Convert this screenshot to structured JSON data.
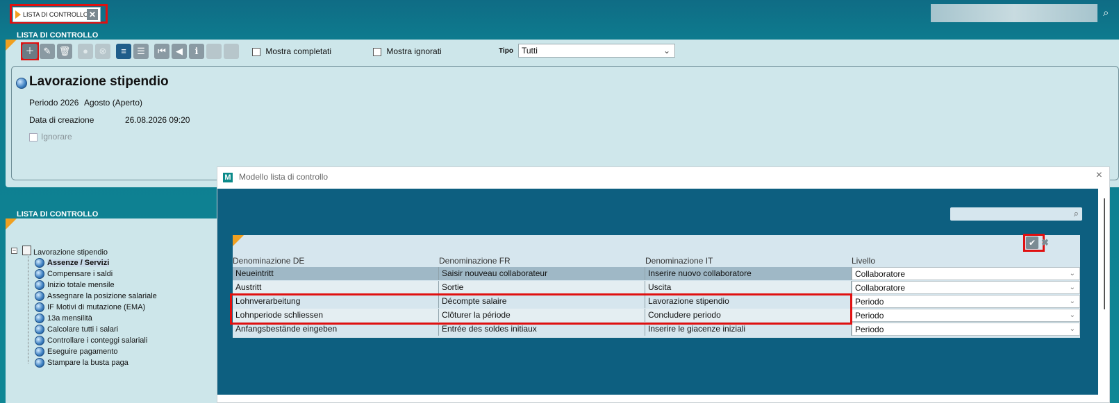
{
  "tab": {
    "label": "LISTA DI CONTROLLO",
    "close": "✕"
  },
  "checklist_section": {
    "title": "LISTA DI CONTROLLO"
  },
  "toolbar": {
    "show_completed": "Mostra completati",
    "show_ignored": "Mostra ignorati",
    "type_label": "Tipo",
    "type_value": "Tutti"
  },
  "detail": {
    "title": "Lavorazione stipendio",
    "period_label": "Periodo 2026",
    "period_value": "Agosto (Aperto)",
    "created_label": "Data di creazione",
    "created_value": "26.08.2026 09:20",
    "ignore_label": "Ignorare"
  },
  "tree_section": {
    "title": "LISTA DI CONTROLLO"
  },
  "tree": {
    "root": "Lavorazione stipendio",
    "items": [
      "Assenze / Servizi",
      "Compensare i saldi",
      "Inizio totale mensile",
      "Assegnare la posizione salariale",
      "IF Motivi di mutazione (EMA)",
      "13a mensilità",
      "Calcolare tutti i salari",
      "Controllare i conteggi salariali",
      "Eseguire pagamento",
      "Stampare la busta paga"
    ]
  },
  "modal": {
    "logo": "M",
    "title": "Modello lista di controllo",
    "close": "×",
    "columns": [
      "Denominazione DE",
      "Denominazione FR",
      "Denominazione IT",
      "Livello"
    ],
    "rows": [
      {
        "de": "Neueintritt",
        "fr": "Saisir nouveau collaborateur",
        "it": "Inserire nuovo collaboratore",
        "level": "Collaboratore"
      },
      {
        "de": "Austritt",
        "fr": "Sortie",
        "it": "Uscita",
        "level": "Collaboratore"
      },
      {
        "de": "Lohnverarbeitung",
        "fr": "Décompte salaire",
        "it": "Lavorazione stipendio",
        "level": "Periodo"
      },
      {
        "de": "Lohnperiode schliessen",
        "fr": "Clôturer la période",
        "it": "Concludere periodo",
        "level": "Periodo"
      },
      {
        "de": "Anfangsbestände eingeben",
        "fr": "Entrée des soldes initiaux",
        "it": "Inserire le giacenze iniziali",
        "level": "Periodo"
      }
    ]
  },
  "colors": {
    "header_teal": "#0e7c8f",
    "panel": "#cde6ea",
    "modal_body": "#0d5f80",
    "highlight_red": "#e01010",
    "accent_orange": "#f0a020"
  }
}
